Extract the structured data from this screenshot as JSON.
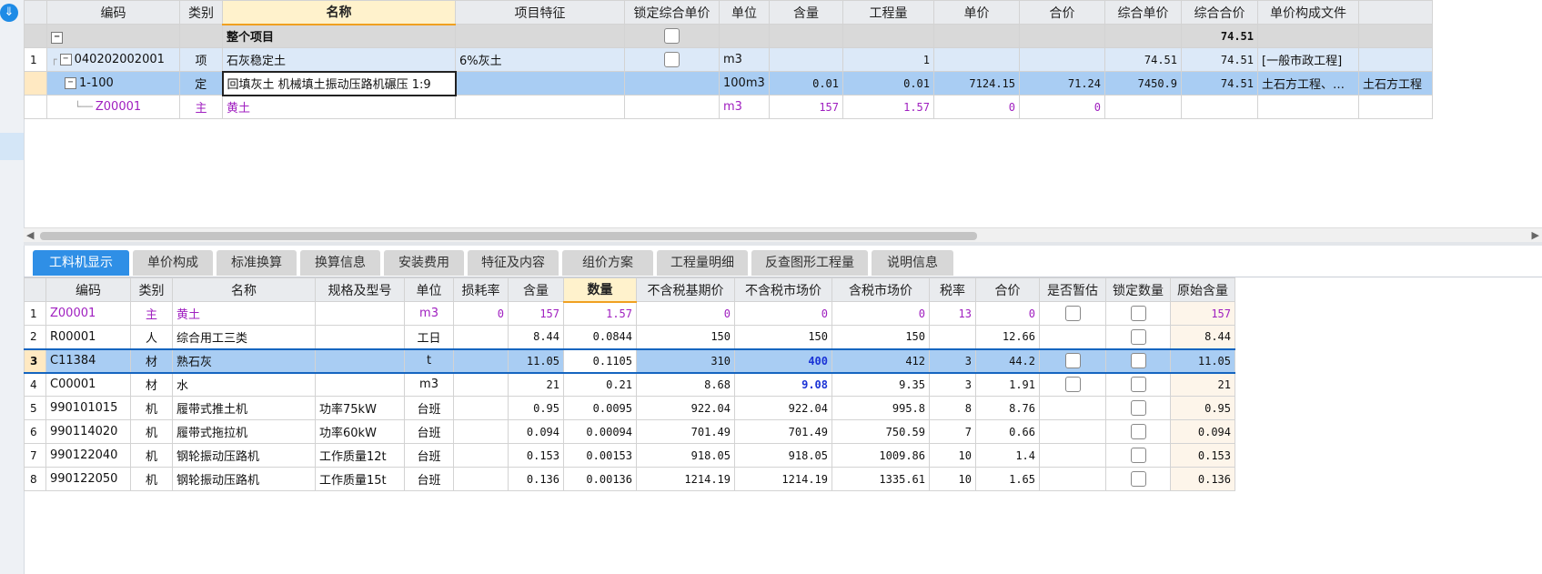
{
  "top_grid": {
    "headers": [
      "编码",
      "类别",
      "名称",
      "项目特征",
      "锁定综合单价",
      "单位",
      "含量",
      "工程量",
      "单价",
      "合价",
      "综合单价",
      "综合合价",
      "单价构成文件",
      ""
    ],
    "rows": [
      {
        "num": "",
        "code": "",
        "type": "",
        "name": "整个项目",
        "feature": "",
        "lock": true,
        "unit": "",
        "content": "",
        "qty": "",
        "price": "",
        "total": "",
        "unit_price": "",
        "unit_total": "74.51",
        "file": "",
        "extra": ""
      },
      {
        "num": "1",
        "code": "040202002001",
        "type": "项",
        "name": "石灰稳定土",
        "feature": "6%灰土",
        "lock": true,
        "unit": "m3",
        "content": "",
        "qty": "1",
        "price": "",
        "total": "",
        "unit_price": "74.51",
        "unit_total": "74.51",
        "file": "[一般市政工程]",
        "extra": ""
      },
      {
        "num": "",
        "code": "1-100",
        "type": "定",
        "name": "回填灰土 机械填土振动压路机碾压 1:9",
        "feature": "",
        "lock": false,
        "unit": "100m3",
        "content": "0.01",
        "qty": "0.01",
        "price": "7124.15",
        "total": "71.24",
        "unit_price": "7450.9",
        "unit_total": "74.51",
        "file": "土石方工程、…",
        "extra": "土石方工程"
      },
      {
        "num": "",
        "code": "Z00001",
        "type": "主",
        "name": "黄土",
        "feature": "",
        "lock": false,
        "unit": "m3",
        "content": "157",
        "qty": "1.57",
        "price": "0",
        "total": "0",
        "unit_price": "",
        "unit_total": "",
        "file": "",
        "extra": ""
      }
    ]
  },
  "tabs": [
    "工料机显示",
    "单价构成",
    "标准换算",
    "换算信息",
    "安装费用",
    "特征及内容",
    "组价方案",
    "工程量明细",
    "反查图形工程量",
    "说明信息"
  ],
  "bottom_grid": {
    "headers": [
      "编码",
      "类别",
      "名称",
      "规格及型号",
      "单位",
      "损耗率",
      "含量",
      "数量",
      "不含税基期价",
      "不含税市场价",
      "含税市场价",
      "税率",
      "合价",
      "是否暂估",
      "锁定数量",
      "原始含量"
    ],
    "rows": [
      {
        "num": "1",
        "code": "Z00001",
        "type": "主",
        "name": "黄土",
        "spec": "",
        "unit": "m3",
        "loss": "0",
        "content": "157",
        "qty": "1.57",
        "base": "0",
        "market": "0",
        "tax_market": "0",
        "rate": "13",
        "total": "0",
        "est": true,
        "lock": true,
        "orig": "157"
      },
      {
        "num": "2",
        "code": "R00001",
        "type": "人",
        "name": "综合用工三类",
        "spec": "",
        "unit": "工日",
        "loss": "",
        "content": "8.44",
        "qty": "0.0844",
        "base": "150",
        "market": "150",
        "tax_market": "150",
        "rate": "",
        "total": "12.66",
        "est": false,
        "lock": true,
        "orig": "8.44"
      },
      {
        "num": "3",
        "code": "C11384",
        "type": "材",
        "name": "熟石灰",
        "spec": "",
        "unit": "t",
        "loss": "",
        "content": "11.05",
        "qty": "0.1105",
        "base": "310",
        "market": "400",
        "tax_market": "412",
        "rate": "3",
        "total": "44.2",
        "est": true,
        "lock": true,
        "orig": "11.05"
      },
      {
        "num": "4",
        "code": "C00001",
        "type": "材",
        "name": "水",
        "spec": "",
        "unit": "m3",
        "loss": "",
        "content": "21",
        "qty": "0.21",
        "base": "8.68",
        "market": "9.08",
        "tax_market": "9.35",
        "rate": "3",
        "total": "1.91",
        "est": true,
        "lock": true,
        "orig": "21"
      },
      {
        "num": "5",
        "code": "990101015",
        "type": "机",
        "name": "履带式推土机",
        "spec": "功率75kW",
        "unit": "台班",
        "loss": "",
        "content": "0.95",
        "qty": "0.0095",
        "base": "922.04",
        "market": "922.04",
        "tax_market": "995.8",
        "rate": "8",
        "total": "8.76",
        "est": false,
        "lock": true,
        "orig": "0.95"
      },
      {
        "num": "6",
        "code": "990114020",
        "type": "机",
        "name": "履带式拖拉机",
        "spec": "功率60kW",
        "unit": "台班",
        "loss": "",
        "content": "0.094",
        "qty": "0.00094",
        "base": "701.49",
        "market": "701.49",
        "tax_market": "750.59",
        "rate": "7",
        "total": "0.66",
        "est": false,
        "lock": true,
        "orig": "0.094"
      },
      {
        "num": "7",
        "code": "990122040",
        "type": "机",
        "name": "钢轮振动压路机",
        "spec": "工作质量12t",
        "unit": "台班",
        "loss": "",
        "content": "0.153",
        "qty": "0.00153",
        "base": "918.05",
        "market": "918.05",
        "tax_market": "1009.86",
        "rate": "10",
        "total": "1.4",
        "est": false,
        "lock": true,
        "orig": "0.153"
      },
      {
        "num": "8",
        "code": "990122050",
        "type": "机",
        "name": "钢轮振动压路机",
        "spec": "工作质量15t",
        "unit": "台班",
        "loss": "",
        "content": "0.136",
        "qty": "0.00136",
        "base": "1214.19",
        "market": "1214.19",
        "tax_market": "1335.61",
        "rate": "10",
        "total": "1.65",
        "est": false,
        "lock": true,
        "orig": "0.136"
      }
    ]
  }
}
